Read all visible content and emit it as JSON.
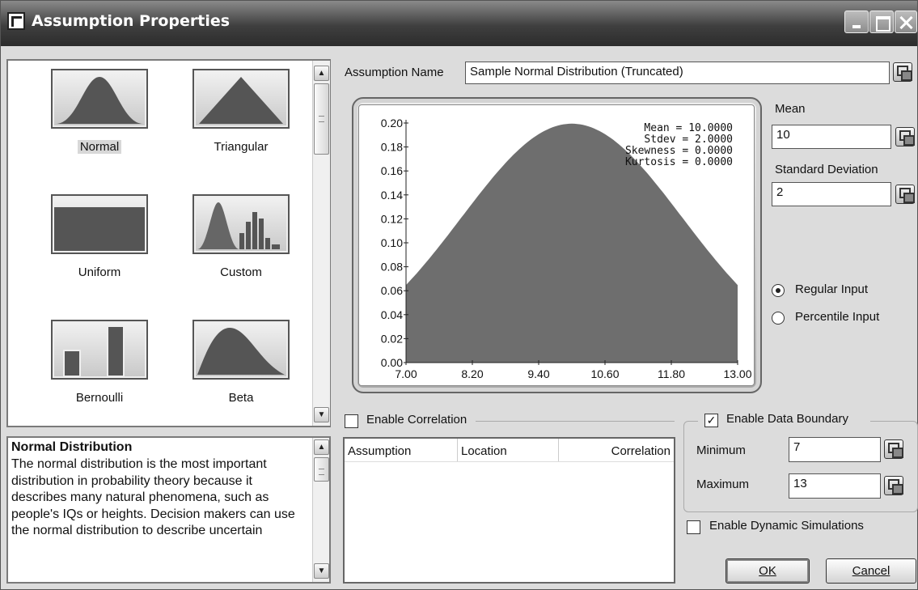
{
  "window": {
    "title": "Assumption Properties"
  },
  "gallery": {
    "items": [
      {
        "label": "Normal",
        "icon": "normal-distribution-icon",
        "selected": true
      },
      {
        "label": "Triangular",
        "icon": "triangular-distribution-icon"
      },
      {
        "label": "Uniform",
        "icon": "uniform-distribution-icon"
      },
      {
        "label": "Custom",
        "icon": "custom-distribution-icon"
      },
      {
        "label": "Bernoulli",
        "icon": "bernoulli-distribution-icon"
      },
      {
        "label": "Beta",
        "icon": "beta-distribution-icon"
      }
    ]
  },
  "description": {
    "title": "Normal Distribution",
    "body": "The normal distribution is the most important distribution in probability theory because it describes many natural phenomena, such as people's IQs or heights. Decision makers can use the normal distribution to describe uncertain"
  },
  "assumption_name": {
    "label": "Assumption Name",
    "value": "Sample Normal Distribution (Truncated)"
  },
  "chart_data": {
    "type": "area",
    "stats": [
      "Mean = 10.0000",
      "Stdev = 2.0000",
      "Skewness = 0.0000",
      "Kurtosis = 0.0000"
    ],
    "xlim": [
      7,
      13
    ],
    "ylim": [
      0,
      0.2
    ],
    "xticks": [
      "7.00",
      "8.20",
      "9.40",
      "10.60",
      "11.80",
      "13.00"
    ],
    "yticks": [
      "0.00",
      "0.02",
      "0.04",
      "0.06",
      "0.08",
      "0.10",
      "0.12",
      "0.14",
      "0.16",
      "0.18",
      "0.20"
    ],
    "distribution": {
      "mean": 10,
      "stdev": 2
    }
  },
  "parameters": {
    "mean": {
      "label": "Mean",
      "value": "10"
    },
    "stdev": {
      "label": "Standard Deviation",
      "value": "2"
    }
  },
  "input_mode": {
    "regular": "Regular Input",
    "percentile": "Percentile Input",
    "selected": "regular"
  },
  "correlation": {
    "checkbox_label": "Enable Correlation",
    "checked": false,
    "columns": [
      "Assumption",
      "Location",
      "Correlation"
    ]
  },
  "boundary": {
    "checkbox_label": "Enable Data Boundary",
    "checked": true,
    "min_label": "Minimum",
    "min_value": "7",
    "max_label": "Maximum",
    "max_value": "13"
  },
  "dynamic": {
    "label": "Enable Dynamic Simulations",
    "checked": false
  },
  "buttons": {
    "ok": "OK",
    "cancel": "Cancel"
  }
}
